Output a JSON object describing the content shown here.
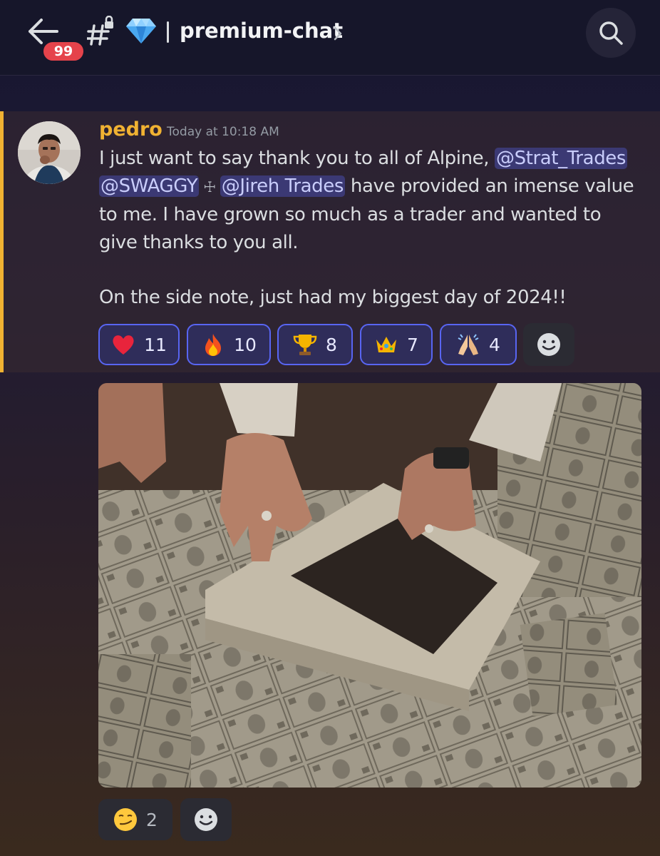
{
  "header": {
    "unread_count": "99",
    "channel_name": "premium-chat",
    "icons": [
      "back-arrow-icon",
      "locked-channel-icon",
      "gem-icon",
      "chevron-right-icon",
      "search-icon"
    ]
  },
  "message": {
    "author": "pedro",
    "timestamp": "Today at 10:18 AM",
    "author_color": "#f0b232",
    "text_intro": "I just want to say thank you to all of Alpine, ",
    "mentions": [
      "@Strat_Trades",
      "@SWAGGY",
      "@Jireh Trades"
    ],
    "mention_badge_glyph": "☩",
    "text_after_mentions": " have provided an imense value to me. I have grown so much as a trader and wanted to give thanks to you all.",
    "text_second_paragraph": "On the side note, just had my biggest day of 2024!!",
    "reactions": [
      {
        "emoji": "heart",
        "count": "11"
      },
      {
        "emoji": "fire",
        "count": "10"
      },
      {
        "emoji": "trophy",
        "count": "8"
      },
      {
        "emoji": "crown",
        "count": "7"
      },
      {
        "emoji": "folded-hands",
        "count": "4"
      }
    ]
  },
  "attachment_message": {
    "image_description": "money-counting-gif",
    "reactions": [
      {
        "emoji": "smirk",
        "count": "2"
      }
    ]
  },
  "colors": {
    "accent": "#5865f2",
    "badge": "#e5434b",
    "highlight_bar": "#f0b232"
  }
}
